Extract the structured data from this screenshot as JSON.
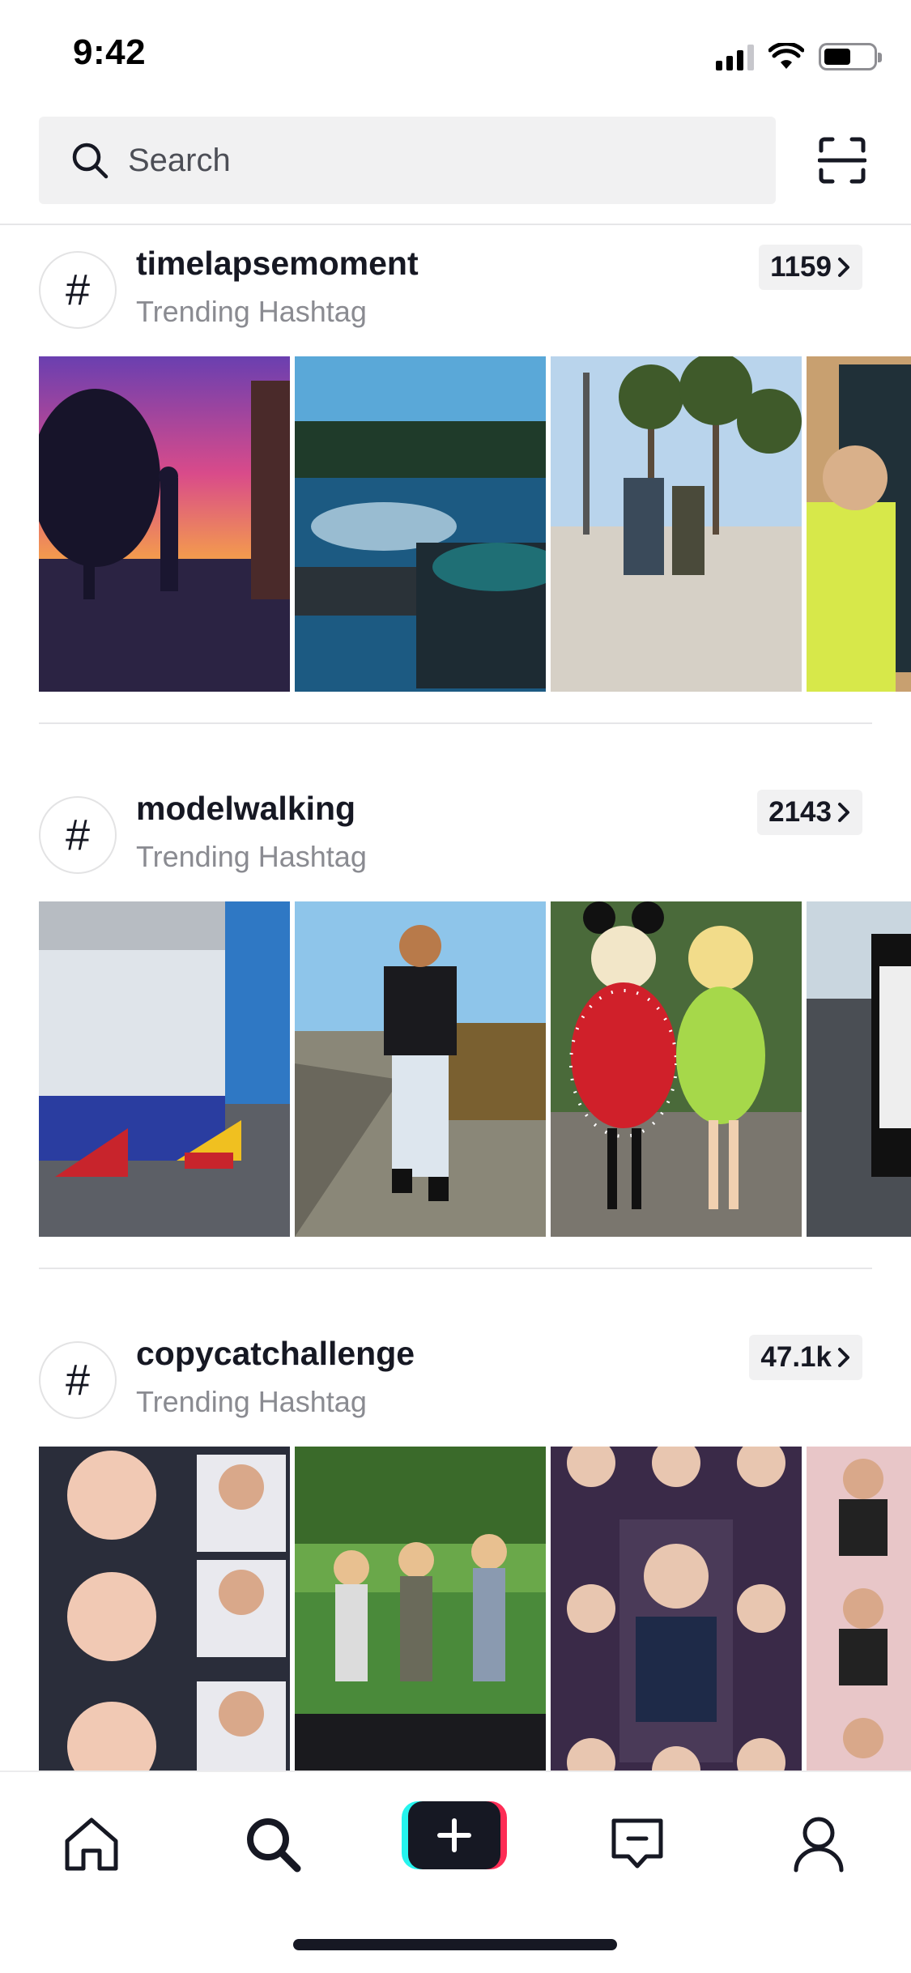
{
  "status_bar": {
    "time": "9:42"
  },
  "search": {
    "placeholder": "Search"
  },
  "hashtags": [
    {
      "name": "timelapsemoment",
      "subtitle": "Trending Hashtag",
      "count": "1159"
    },
    {
      "name": "modelwalking",
      "subtitle": "Trending Hashtag",
      "count": "2143"
    },
    {
      "name": "copycatchallenge",
      "subtitle": "Trending Hashtag",
      "count": "47.1k"
    }
  ],
  "icons": {
    "search": "search-icon",
    "scan": "scan-icon",
    "hashtag": "hashtag-icon",
    "chevron": "chevron-right-icon",
    "tabs": [
      "home-icon",
      "discover-icon",
      "create-icon",
      "inbox-icon",
      "profile-icon"
    ]
  },
  "colors": {
    "cyan": "#25f4ee",
    "pink": "#fe2c55",
    "ink": "#161823",
    "chip": "#f1f1f2"
  }
}
